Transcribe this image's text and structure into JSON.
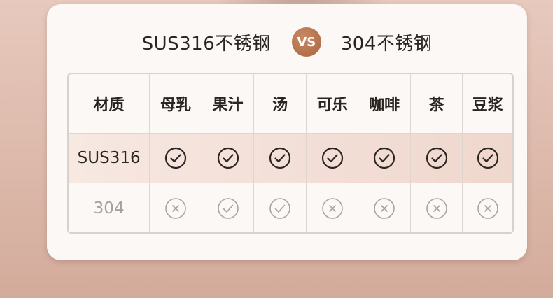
{
  "header": {
    "left_title": "SUS316不锈钢",
    "vs": "VS",
    "right_title": "304不锈钢"
  },
  "table": {
    "columns": [
      "材质",
      "母乳",
      "果汁",
      "汤",
      "可乐",
      "咖啡",
      "茶",
      "豆浆"
    ],
    "rows": [
      {
        "label": "SUS316",
        "cells": [
          "check",
          "check",
          "check",
          "check",
          "check",
          "check",
          "check"
        ]
      },
      {
        "label": "304",
        "cells": [
          "cross",
          "check",
          "check",
          "cross",
          "cross",
          "cross",
          "cross"
        ]
      }
    ]
  },
  "colors": {
    "accent": "#b06d48",
    "check_dark": "#2b2522",
    "icon_muted": "#aaa39e",
    "highlight_row": "#f2ddd5"
  }
}
